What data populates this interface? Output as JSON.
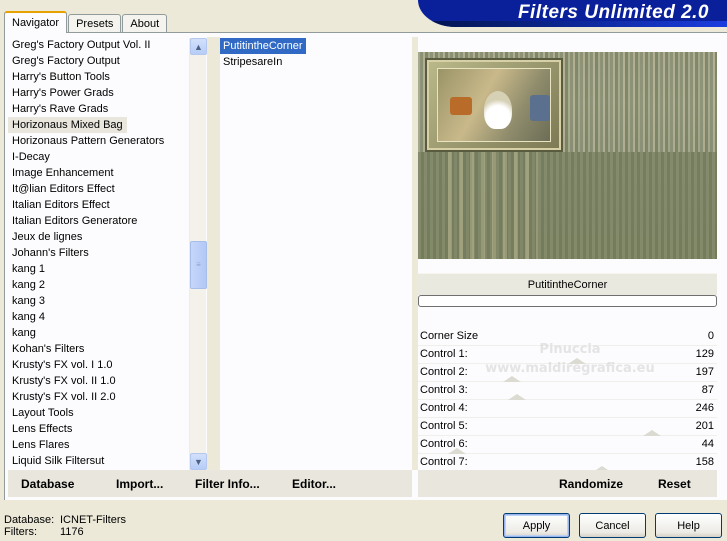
{
  "tabs": [
    {
      "label": "Navigator",
      "active": true
    },
    {
      "label": "Presets",
      "active": false
    },
    {
      "label": "About",
      "active": false
    }
  ],
  "banner_title": "Filters Unlimited 2.0",
  "categories": [
    "Greg's Factory Output Vol. II",
    "Greg's Factory Output",
    "Harry's Button Tools",
    "Harry's Power Grads",
    "Harry's Rave Grads",
    "Horizonaus Mixed Bag",
    "Horizonaus Pattern Generators",
    "I-Decay",
    "Image Enhancement",
    "It@lian Editors Effect",
    "Italian Editors Effect",
    "Italian Editors Generatore",
    "Jeux de lignes",
    "Johann's Filters",
    "kang 1",
    "kang 2",
    "kang 3",
    "kang 4",
    "kang",
    "Kohan's Filters",
    "Krusty's FX vol. I 1.0",
    "Krusty's FX vol. II 1.0",
    "Krusty's FX vol. II 2.0",
    "Layout Tools",
    "Lens Effects",
    "Lens Flares",
    "Liquid Silk Filtersut"
  ],
  "selected_category": "Horizonaus Mixed Bag",
  "filters": [
    "PutitintheCorner",
    "StripesareIn"
  ],
  "selected_filter": "PutitintheCorner",
  "scroll_icons": {
    "up": "chevron-up-icon",
    "down": "chevron-down-icon",
    "grip": "grip-icon"
  },
  "scroll_position": 0.53,
  "filter_name_display": "PutitintheCorner",
  "progress": 0,
  "controls": [
    {
      "label": "Corner Size",
      "value": "0"
    },
    {
      "label": "Control 1:",
      "value": "129"
    },
    {
      "label": "Control 2:",
      "value": "197"
    },
    {
      "label": "Control 3:",
      "value": "87"
    },
    {
      "label": "Control 4:",
      "value": "246"
    },
    {
      "label": "Control 5:",
      "value": "201"
    },
    {
      "label": "Control 6:",
      "value": "44"
    },
    {
      "label": "Control 7:",
      "value": "158"
    }
  ],
  "watermark": {
    "line1": "Pinuccia",
    "line2": "www.maldiregrafica.eu"
  },
  "toolbar": {
    "database": "Database",
    "import": "Import...",
    "filter_info": "Filter Info...",
    "editor": "Editor...",
    "randomize": "Randomize",
    "reset": "Reset"
  },
  "status": {
    "database_label": "Database:",
    "database_value": "ICNET-Filters",
    "filters_label": "Filters:",
    "filters_value": "1176"
  },
  "buttons": {
    "apply": "Apply",
    "cancel": "Cancel",
    "help": "Help"
  },
  "colors": {
    "selection": "#316ac5",
    "banner": "#0a1f9a",
    "tab_highlight": "#e8a200"
  }
}
